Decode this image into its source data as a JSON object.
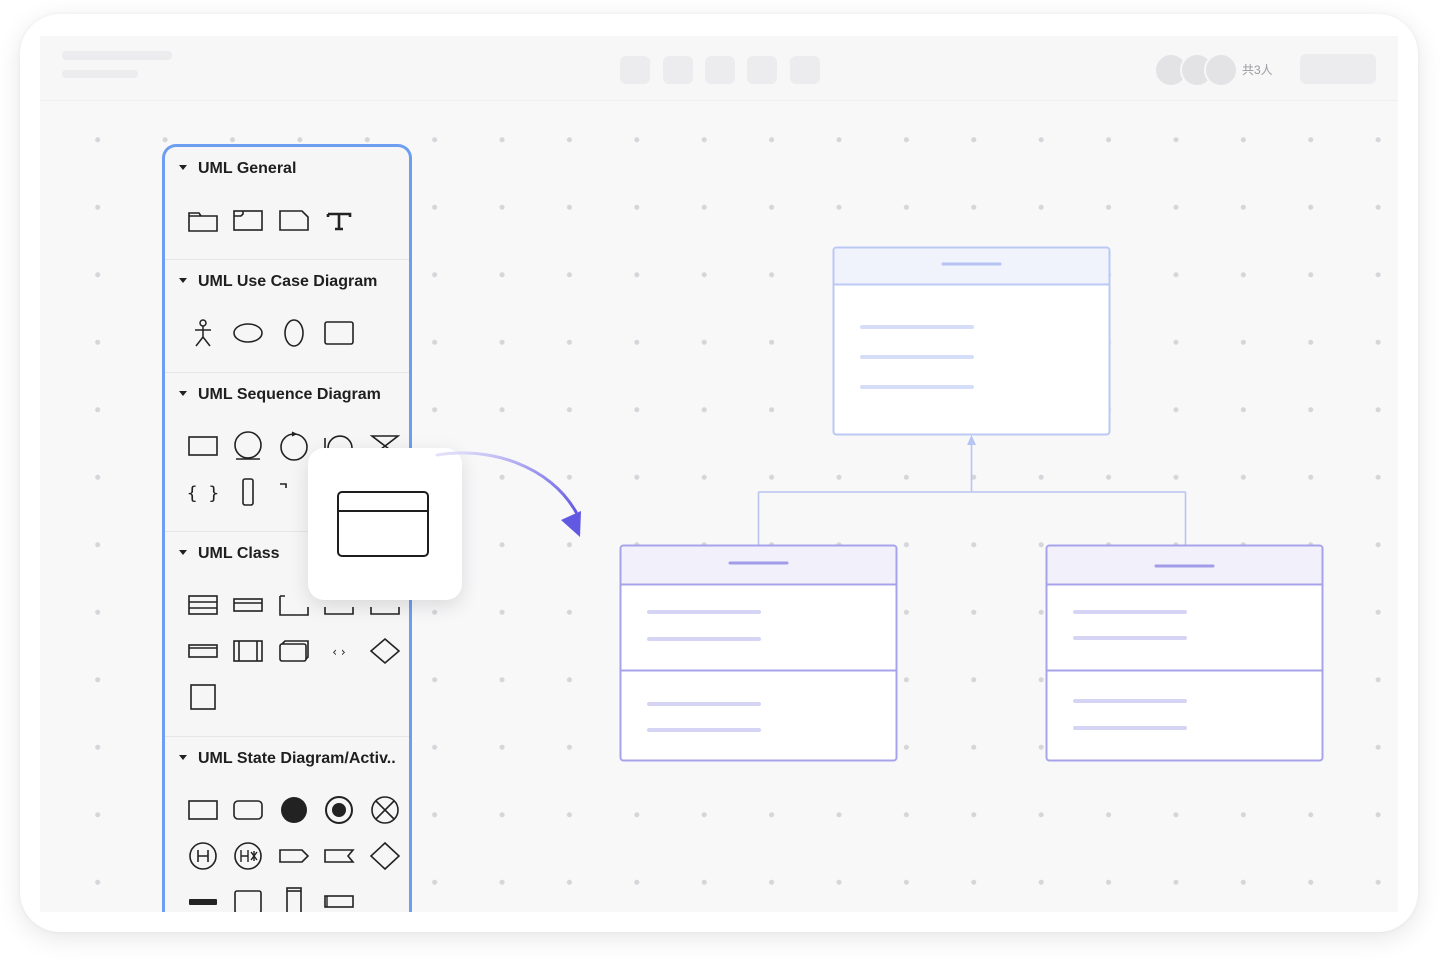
{
  "topbar": {
    "collaborator_count": "共3人",
    "toolbar_icons": [
      "toolbar-tool-1",
      "toolbar-tool-2",
      "toolbar-tool-3",
      "toolbar-tool-4",
      "toolbar-tool-5"
    ]
  },
  "sidebar": {
    "sections": [
      {
        "title": "UML General",
        "shapes": [
          "package-icon",
          "frame-icon",
          "note-icon",
          "text-icon"
        ]
      },
      {
        "title": "UML Use Case Diagram",
        "shapes": [
          "actor-icon",
          "use-case-ellipse-icon",
          "vertical-ellipse-icon",
          "system-boundary-icon"
        ]
      },
      {
        "title": "UML Sequence Diagram",
        "shapes": [
          "lifeline-box-icon",
          "entity-icon",
          "control-icon",
          "boundary-icon",
          "hourglass-icon",
          "braces-icon",
          "activation-bar-icon",
          "fragment-icon"
        ]
      },
      {
        "title": "UML Class",
        "shapes": [
          "class-icon",
          "interface-icon",
          "object-icon",
          "shape-4-icon",
          "shape-5-icon",
          "class-simple-icon",
          "component-icon",
          "node-3d-icon",
          "template-icon",
          "decision-diamond-icon",
          "square-icon"
        ]
      },
      {
        "title": "UML State Diagram/Activ..",
        "shapes": [
          "state-icon",
          "rounded-state-icon",
          "initial-state-icon",
          "final-state-icon",
          "terminate-icon",
          "shallow-history-icon",
          "deep-history-icon",
          "send-signal-icon",
          "receive-signal-icon",
          "choice-diamond-icon",
          "fork-bar-icon",
          "rounded-square-icon",
          "vertical-bar-icon",
          "horizontal-rect-icon"
        ]
      }
    ]
  },
  "drag_preview": {
    "shape": "class-icon"
  },
  "colors": {
    "panel_border": "#6d9ef0",
    "diagram_stroke": "#a7a3ea",
    "diagram_header": "#f1f0fb",
    "arrow": "#6b63e6",
    "connector": "#b8c4f2",
    "canvas": "#f8f8f9"
  }
}
